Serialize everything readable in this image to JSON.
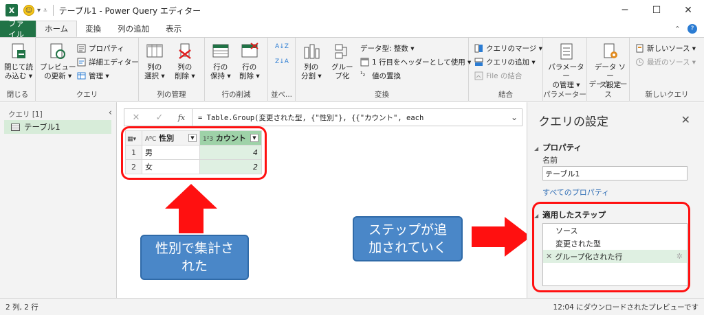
{
  "window": {
    "title": "テーブル1 - Power Query エディター",
    "app_icon_label": "X"
  },
  "tabs": [
    {
      "label": "ファイル"
    },
    {
      "label": "ホーム"
    },
    {
      "label": "変換"
    },
    {
      "label": "列の追加"
    },
    {
      "label": "表示"
    }
  ],
  "ribbon": {
    "close": {
      "load_label_1": "閉じて読",
      "load_label_2": "み込む ▾",
      "group": "閉じる"
    },
    "query": {
      "refresh_label_1": "プレビュー",
      "refresh_label_2": "の更新 ▾",
      "properties": "プロパティ",
      "advanced_editor": "詳細エディター",
      "manage": "管理 ▾",
      "group": "クエリ"
    },
    "manage_columns": {
      "choose_1": "列の",
      "choose_2": "選択 ▾",
      "remove_1": "列の",
      "remove_2": "削除 ▾",
      "group": "列の管理"
    },
    "reduce_rows": {
      "keep_1": "行の",
      "keep_2": "保持 ▾",
      "remove_1": "行の",
      "remove_2": "削除 ▾",
      "group": "行の削減"
    },
    "sort": {
      "group": "並べ..."
    },
    "transform": {
      "split_1": "列の",
      "split_2": "分割 ▾",
      "group_by_1": "グルー",
      "group_by_2": "プ化",
      "data_type": "データ型: 整数 ▾",
      "use_first_row": "1 行目をヘッダーとして使用 ▾",
      "replace_values": "値の置換",
      "group": "変換"
    },
    "combine": {
      "merge": "クエリのマージ ▾",
      "append": "クエリの追加 ▾",
      "combine_files": "File の結合",
      "group": "結合"
    },
    "parameters": {
      "manage_1": "パラメーター",
      "manage_2": "の管理 ▾",
      "group": "パラメーター"
    },
    "data_sources": {
      "settings_1": "データ ソー",
      "settings_2": "ス設定",
      "group": "データ ソース"
    },
    "new_query": {
      "new_source": "新しいソース ▾",
      "recent_sources": "最近のソース ▾",
      "group": "新しいクエリ"
    }
  },
  "queries_pane": {
    "header": "クエリ [1]",
    "items": [
      {
        "label": "テーブル1"
      }
    ]
  },
  "formula_bar": {
    "cancel": "✕",
    "commit": "✓",
    "fx": "fx",
    "formula": "= Table.Group(変更された型, {\"性別\"}, {{\"カウント\", each"
  },
  "grid": {
    "columns": [
      {
        "type_icon": "AᴮC",
        "name": "性別"
      },
      {
        "type_icon": "1²3",
        "name": "カウント"
      }
    ],
    "rows": [
      {
        "n": "1",
        "gender": "男",
        "count": "4"
      },
      {
        "n": "2",
        "gender": "女",
        "count": "2"
      }
    ]
  },
  "annotations": {
    "left_callout": "性別で集計さ\nれた",
    "right_callout": "ステップが追\n加されていく",
    "accent_red": "#ff1010",
    "callout_blue": "#4a87c8"
  },
  "settings_pane": {
    "title": "クエリの設定",
    "properties_header": "プロパティ",
    "name_label": "名前",
    "name_value": "テーブル1",
    "all_properties": "すべてのプロパティ",
    "steps_header": "適用したステップ",
    "steps": [
      {
        "label": "ソース"
      },
      {
        "label": "変更された型"
      },
      {
        "label": "グループ化された行"
      }
    ]
  },
  "status": {
    "left": "2 列, 2 行",
    "right": "12:04 にダウンロードされたプレビューです"
  }
}
